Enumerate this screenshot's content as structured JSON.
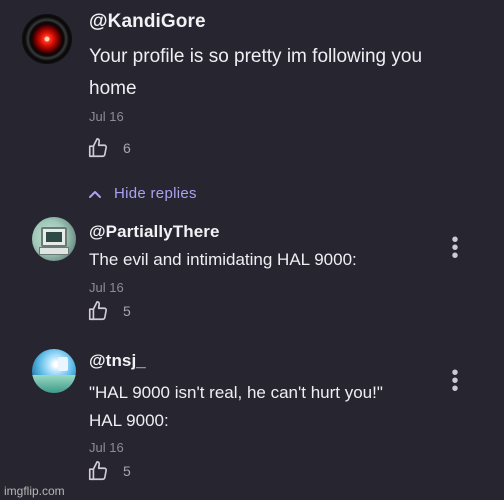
{
  "comments": [
    {
      "username": "@KandiGore",
      "text_lines": [
        "Your profile is so pretty im following you",
        "home"
      ],
      "date": "Jul 16",
      "likes": "6",
      "avatar": "hal-9000-eye-avatar"
    }
  ],
  "replies_toggle": {
    "label": "Hide replies",
    "icon": "chevron-up-icon"
  },
  "replies": [
    {
      "username": "@PartiallyThere",
      "text_lines": [
        "The evil and intimidating HAL 9000:"
      ],
      "date": "Jul 16",
      "likes": "5",
      "avatar": "retro-computer-avatar"
    },
    {
      "username": "@tnsj_",
      "text_lines": [
        "\"HAL 9000 isn't real, he can't hurt you!\"",
        "HAL 9000:"
      ],
      "date": "Jul 16",
      "likes": "5",
      "avatar": "vaporwave-avatar"
    }
  ],
  "watermark": "imgflip.com",
  "colors": {
    "background": "#27252f",
    "accent": "#a9a3f0",
    "muted": "#8f8c98"
  }
}
